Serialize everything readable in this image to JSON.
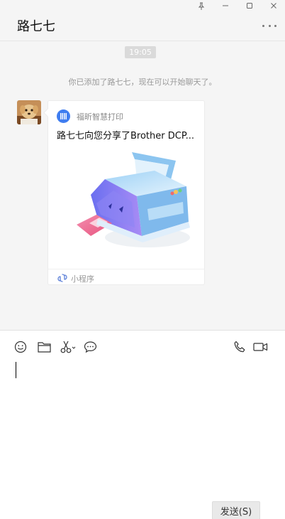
{
  "window": {
    "title": "路七七",
    "controls": [
      "pin-icon",
      "minimize-icon",
      "maximize-icon",
      "close-icon"
    ]
  },
  "chat": {
    "time": "19:05",
    "system_message": "你已添加了路七七，现在可以开始聊天了。",
    "card": {
      "app_name": "福昕智慧打印",
      "title": "路七七向您分享了Brother DCP...",
      "footer_label": "小程序",
      "icon": "printer-illustration"
    }
  },
  "toolbar": {
    "icons": [
      "emoji-icon",
      "folder-icon",
      "scissors-icon",
      "chat-bubble-icon",
      "phone-icon",
      "video-icon"
    ]
  },
  "input": {
    "value": "",
    "send_label": "发送(S)"
  },
  "colors": {
    "background": "#f5f5f5",
    "input_bg": "#ffffff",
    "accent_blue": "#3f7df0"
  }
}
